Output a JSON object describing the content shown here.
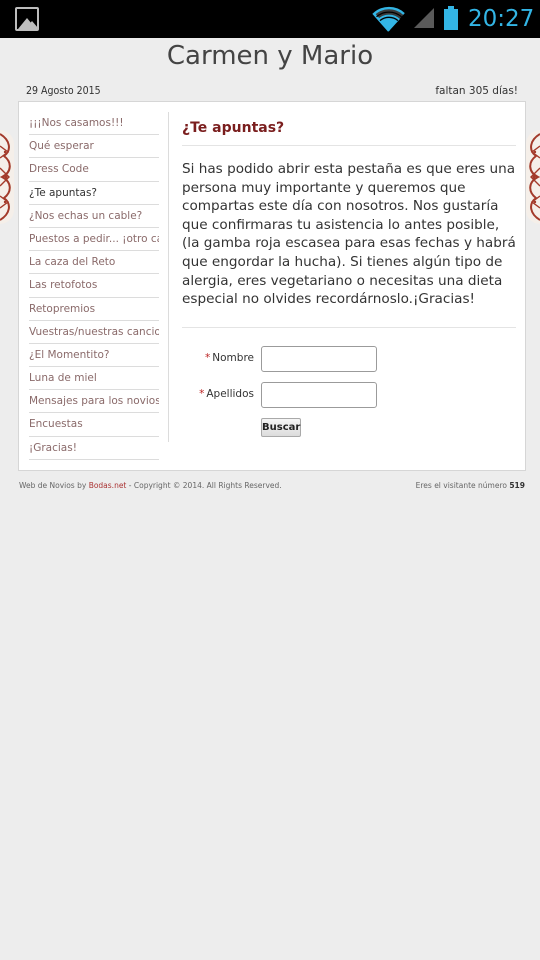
{
  "status_bar": {
    "time": "20:27",
    "accent_color": "#33b5e5",
    "icons": [
      "gallery-notification-icon",
      "wifi-icon",
      "signal-icon",
      "battery-icon"
    ]
  },
  "header": {
    "title": "Carmen y Mario",
    "date": "29 Agosto 2015",
    "countdown": "faltan 305 días!"
  },
  "sidebar": {
    "items": [
      {
        "label": "¡¡¡Nos casamos!!!"
      },
      {
        "label": "Qué esperar"
      },
      {
        "label": "Dress Code"
      },
      {
        "label": "¿Te apuntas?"
      },
      {
        "label": "¿Nos echas un cable?"
      },
      {
        "label": "Puestos a pedir... ¡otro cable!"
      },
      {
        "label": "La caza del Reto"
      },
      {
        "label": "Las retofotos"
      },
      {
        "label": "Retopremios"
      },
      {
        "label": "Vuestras/nuestras canciones"
      },
      {
        "label": "¿El Momentito?"
      },
      {
        "label": "Luna de miel"
      },
      {
        "label": "Mensajes para los novios"
      },
      {
        "label": "Encuestas"
      },
      {
        "label": "¡Gracias!"
      }
    ],
    "active_index": 3
  },
  "main": {
    "title": "¿Te apuntas?",
    "intro": "Si has podido abrir esta pestaña es que eres una persona muy importante y queremos que compartas este día con nosotros. Nos gustaría que confirmaras tu asistencia lo antes posible, (la gamba roja escasea para esas fechas y habrá que engordar la hucha). Si tienes algún tipo de alergia, eres vegetariano o necesitas una dieta especial no olvides recordárnoslo.¡Gracias!",
    "form": {
      "required_mark": "*",
      "first_name_label": "Nombre",
      "first_name_value": "",
      "last_name_label": "Apellidos",
      "last_name_value": "",
      "submit_label": "Buscar"
    }
  },
  "footer": {
    "prefix": "Web de Novios by ",
    "brand": "Bodas.net",
    "copyright": " - Copyright © 2014. All Rights Reserved.",
    "visitor_text": "Eres el visitante número ",
    "visitor_count": "519"
  },
  "colors": {
    "accent_title": "#7a1e1e",
    "menu_link": "#8a6a6a",
    "decoration": "#a33a2a"
  }
}
